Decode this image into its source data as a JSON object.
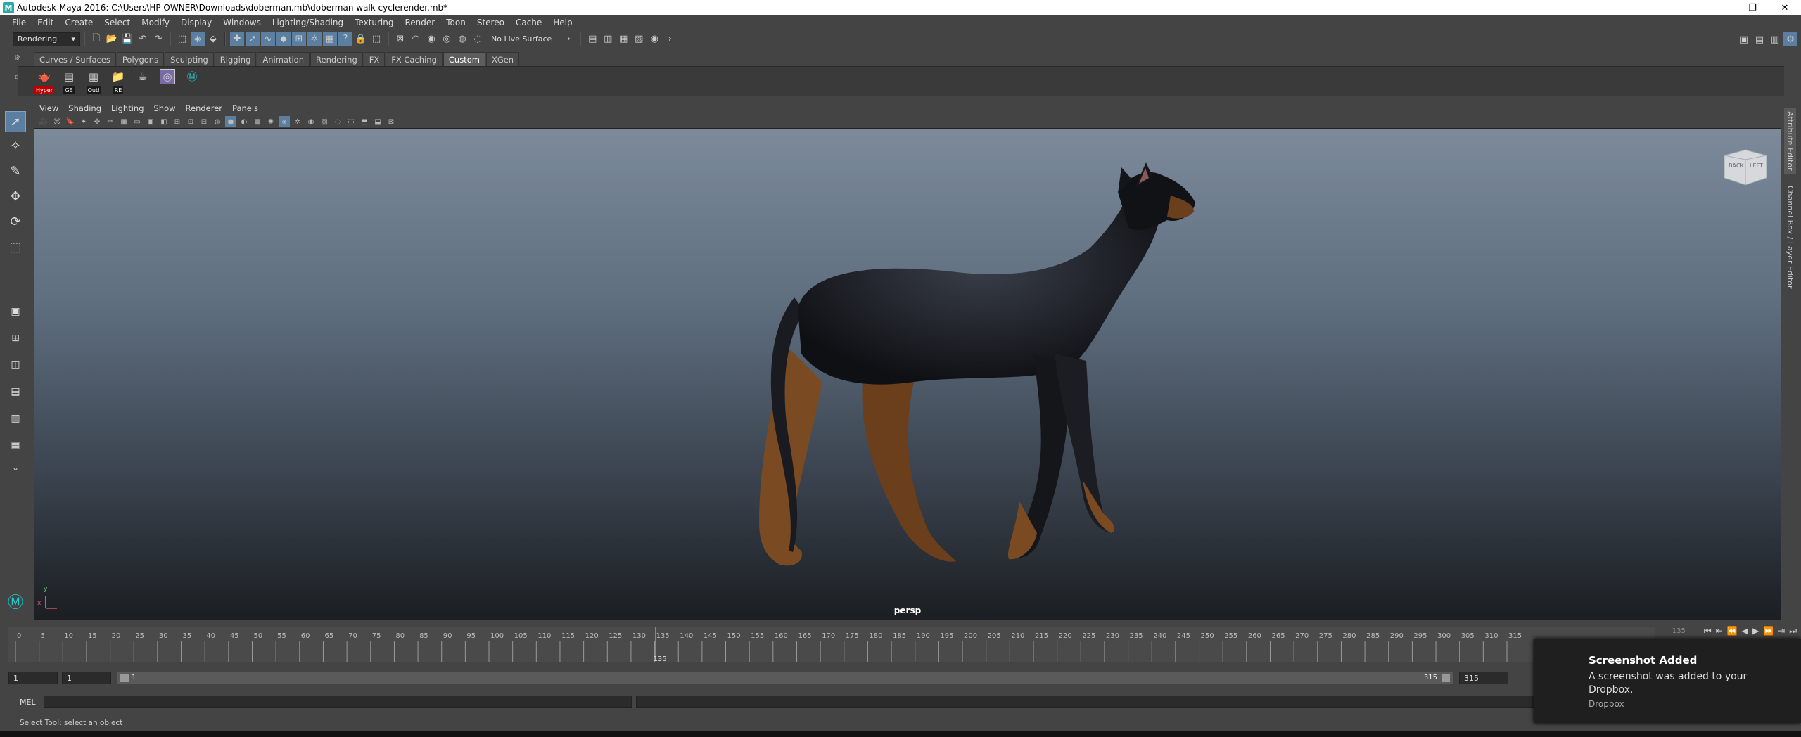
{
  "window": {
    "title": "Autodesk Maya 2016: C:\\Users\\HP OWNER\\Downloads\\doberman.mb\\doberman walk cyclerender.mb*",
    "controls": [
      "–",
      "❐",
      "✕"
    ]
  },
  "menubar": [
    "File",
    "Edit",
    "Create",
    "Select",
    "Modify",
    "Display",
    "Windows",
    "Lighting/Shading",
    "Texturing",
    "Render",
    "Toon",
    "Stereo",
    "Cache",
    "Help"
  ],
  "status": {
    "menuset": "Rendering",
    "live_surface": "No Live Surface"
  },
  "shelf": {
    "tabs": [
      "Curves / Surfaces",
      "Polygons",
      "Sculpting",
      "Rigging",
      "Animation",
      "Rendering",
      "FX",
      "FX Caching",
      "Custom",
      "XGen"
    ],
    "active_tab": "Custom",
    "buttons": [
      {
        "label": "Hyper",
        "icon": "render-icon"
      },
      {
        "label": "GE",
        "icon": "graph-editor-icon"
      },
      {
        "label": "Outl",
        "icon": "outliner-icon"
      },
      {
        "label": "RE",
        "icon": "folder-icon"
      },
      {
        "label": "",
        "icon": "teapot-icon"
      },
      {
        "label": "",
        "icon": "hypershade-icon"
      },
      {
        "label": "",
        "icon": "maya-logo-icon"
      }
    ]
  },
  "panel": {
    "menus": [
      "View",
      "Shading",
      "Lighting",
      "Show",
      "Renderer",
      "Panels"
    ],
    "camera": "persp",
    "viewcube": {
      "face1": "BACK",
      "face2": "LEFT"
    },
    "axis_y": "y",
    "axis_x": "x"
  },
  "right_dock": {
    "tab1": "Attribute Editor",
    "tab2": "Channel Box / Layer Editor"
  },
  "timeline": {
    "ticks": [
      0,
      5,
      10,
      15,
      20,
      25,
      30,
      35,
      40,
      45,
      50,
      55,
      60,
      65,
      70,
      75,
      80,
      85,
      90,
      95,
      100,
      105,
      110,
      115,
      120,
      125,
      130,
      135,
      140,
      145,
      150,
      155,
      160,
      165,
      170,
      175,
      180,
      185,
      190,
      195,
      200,
      205,
      210,
      215,
      220,
      225,
      230,
      235,
      240,
      245,
      250,
      255,
      260,
      265,
      270,
      275,
      280,
      285,
      290,
      295,
      300,
      305,
      310,
      315
    ],
    "current_frame": "135",
    "current_box": "135",
    "min": 0,
    "max": 315
  },
  "range": {
    "start": "1",
    "anim_start": "1",
    "range_start": "1",
    "range_end": "315",
    "anim_end": "315"
  },
  "command": {
    "mode": "MEL"
  },
  "helpline": "Select Tool: select an object",
  "toast": {
    "title": "Screenshot Added",
    "message": "A screenshot was added to your Dropbox.",
    "source": "Dropbox"
  }
}
